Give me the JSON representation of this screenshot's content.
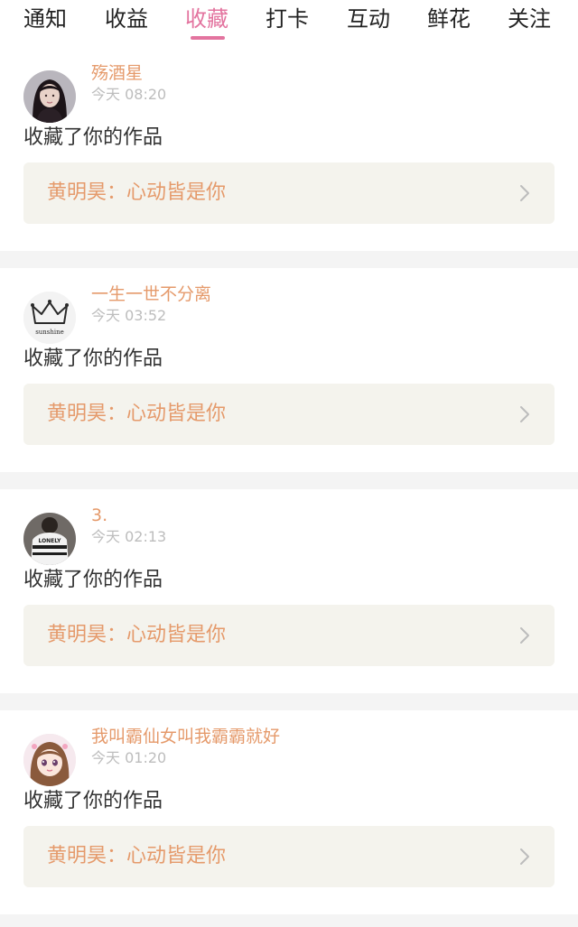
{
  "tabs": [
    {
      "label": "通知"
    },
    {
      "label": "收益"
    },
    {
      "label": "收藏"
    },
    {
      "label": "打卡"
    },
    {
      "label": "互动"
    },
    {
      "label": "鲜花"
    },
    {
      "label": "关注"
    }
  ],
  "active_tab": "收藏",
  "colors": {
    "accent": "#e3749f",
    "username": "#e59a6b",
    "work_box_bg": "#f4f3ed",
    "divider_bg": "#f4f4f4"
  },
  "notifications": [
    {
      "username": "殇酒星",
      "time": "今天 08:20",
      "action": "收藏了你的作品",
      "work": "黄明昊：心动皆是你",
      "avatar": "woman-portrait-avatar"
    },
    {
      "username": "一生一世不分离",
      "time": "今天 03:52",
      "action": "收藏了你的作品",
      "work": "黄明昊：心动皆是你",
      "avatar": "crown-sunshine-avatar",
      "avatar_text": "sunshine"
    },
    {
      "username": "3.",
      "time": "今天 02:13",
      "action": "收藏了你的作品",
      "work": "黄明昊：心动皆是你",
      "avatar": "lonely-shirt-avatar",
      "avatar_text": "LONELY"
    },
    {
      "username": "我叫霸仙女叫我霸霸就好",
      "time": "今天 01:20",
      "action": "收藏了你的作品",
      "work": "黄明昊：心动皆是你",
      "avatar": "anime-girl-avatar"
    }
  ]
}
